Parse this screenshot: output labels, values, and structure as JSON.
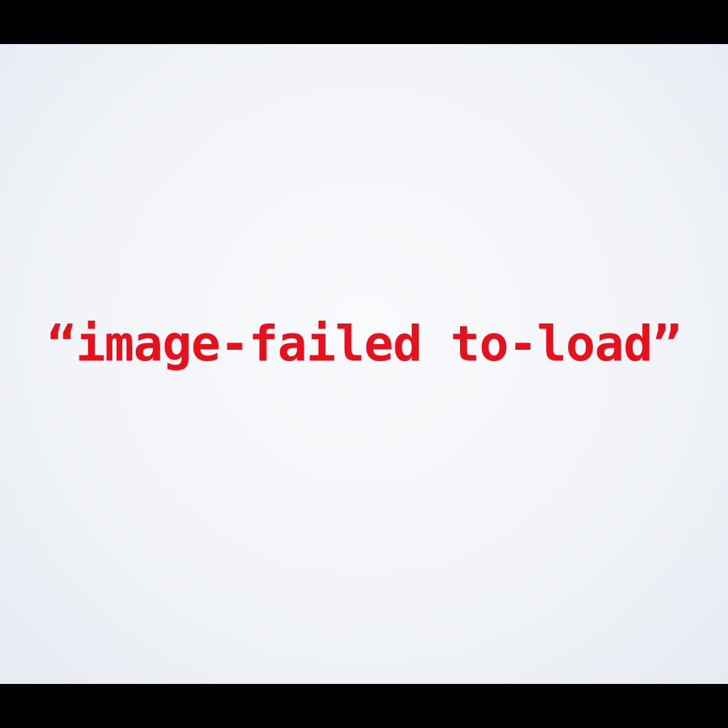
{
  "message": {
    "text": "“image-failed to-load”",
    "color": "#e8101a"
  },
  "colors": {
    "letterbox": "#000000",
    "background": "#f2f4f8"
  }
}
